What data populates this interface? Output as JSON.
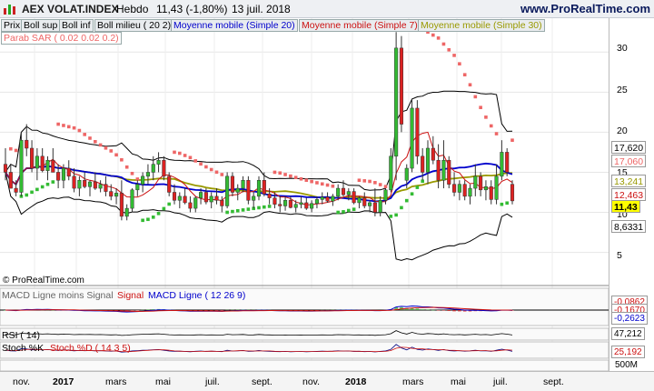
{
  "header": {
    "title": "AEX VOLAT.INDEX",
    "period": "Hebdo",
    "price": "11,43 (-1,80%)",
    "date": "13 juil. 2018",
    "site": "www.ProRealTime.com"
  },
  "toolbar": {
    "prix": "Prix",
    "boll_sup": "Boll sup",
    "boll_inf": "Boll inf",
    "boll_milieu": "Boll milieu ( 20 2)",
    "mm20": "Moyenne mobile (Simple 20)",
    "mm7": "Moyenne mobile (Simple 7)",
    "mm30": "Moyenne mobile (Simple 30)",
    "sar": "Parab SAR ( 0.02 0.02 0.2)"
  },
  "colors": {
    "candle_up": "#33bb33",
    "candle_down": "#dd2222",
    "bollinger": "#000000",
    "mm20": "#0000cc",
    "mm7": "#cc1111",
    "mm30": "#999900",
    "sar_up": "#33bb33",
    "sar_down": "#ee6666"
  },
  "price_axis": {
    "ticks": [
      "30",
      "25",
      "20",
      "15",
      "10",
      "5"
    ],
    "badges": [
      {
        "label": "17,620",
        "color": "#000000",
        "bg": "#ffffff"
      },
      {
        "label": "17,060",
        "color": "#ee6666",
        "bg": "#ffffff"
      },
      {
        "label": "13,241",
        "color": "#999900",
        "bg": "#ffffff"
      },
      {
        "label": "12,463",
        "color": "#cc1111",
        "bg": "#ffffff"
      },
      {
        "label": "11,43",
        "color": "#000000",
        "bg": "#ffff00"
      },
      {
        "label": "8,6331",
        "color": "#000000",
        "bg": "#ffffff"
      }
    ]
  },
  "chart_data": {
    "type": "candlestick",
    "ylim": [
      2,
      34
    ],
    "candles": [
      [
        16,
        18,
        14,
        15
      ],
      [
        15,
        16,
        13,
        13
      ],
      [
        13,
        14,
        12,
        12.5
      ],
      [
        12.5,
        20,
        12,
        19
      ],
      [
        19,
        21,
        17,
        18
      ],
      [
        18,
        19,
        15,
        15.5
      ],
      [
        15.5,
        18,
        14,
        17
      ],
      [
        17,
        18,
        15,
        15.2
      ],
      [
        15.2,
        17,
        14,
        16.5
      ],
      [
        16.5,
        18,
        15,
        15
      ],
      [
        15,
        16,
        13,
        14
      ],
      [
        14,
        16,
        13,
        15.5
      ],
      [
        15.5,
        16.5,
        14,
        14.5
      ],
      [
        14.5,
        15.5,
        12.5,
        13
      ],
      [
        13,
        14.5,
        12,
        14
      ],
      [
        14,
        15,
        13,
        13.2
      ],
      [
        13.2,
        14,
        12,
        13.8
      ],
      [
        13.8,
        15,
        12.8,
        13
      ],
      [
        13,
        14,
        12.5,
        13.5
      ],
      [
        13.5,
        14.5,
        12,
        12.6
      ],
      [
        12.6,
        13.5,
        11.5,
        12
      ],
      [
        12,
        13,
        11,
        12.4
      ],
      [
        12.4,
        14,
        9,
        9.5
      ],
      [
        9.5,
        11,
        9,
        10.5
      ],
      [
        10.5,
        13,
        10,
        12.8
      ],
      [
        12.8,
        14,
        12,
        13.5
      ],
      [
        13.5,
        15,
        12.5,
        14.5
      ],
      [
        14.5,
        16,
        13.5,
        15
      ],
      [
        15,
        17,
        14,
        16
      ],
      [
        16,
        17.5,
        15,
        16.5
      ],
      [
        16.5,
        17,
        14,
        14.5
      ],
      [
        14.5,
        15,
        12,
        12.5
      ],
      [
        12.5,
        13.5,
        11,
        11.5
      ],
      [
        11.5,
        12.5,
        10.5,
        12
      ],
      [
        12,
        13,
        11,
        11.2
      ],
      [
        11.2,
        12,
        10,
        10.5
      ],
      [
        10.5,
        12,
        10,
        11.8
      ],
      [
        11.8,
        13,
        11,
        12.5
      ],
      [
        12.5,
        13,
        11,
        11.3
      ],
      [
        11.3,
        12.5,
        10.5,
        12
      ],
      [
        12,
        13,
        11,
        11.5
      ],
      [
        11.5,
        12,
        10,
        10.8
      ],
      [
        10.8,
        15,
        10.5,
        14.5
      ],
      [
        14.5,
        15,
        12,
        12.5
      ],
      [
        12.5,
        13.5,
        11.5,
        13
      ],
      [
        13,
        14.5,
        12.5,
        14
      ],
      [
        14,
        14.5,
        11,
        11.5
      ],
      [
        11.5,
        12.5,
        10.5,
        12
      ],
      [
        12,
        14.5,
        11.5,
        14
      ],
      [
        14,
        15,
        12,
        12.3
      ],
      [
        12.3,
        13,
        11,
        11.8
      ],
      [
        11.8,
        12.5,
        10.5,
        11
      ],
      [
        11,
        12,
        10,
        10.8
      ],
      [
        10.8,
        12,
        10.2,
        11.5
      ],
      [
        11.5,
        12,
        10.5,
        10.6
      ],
      [
        10.6,
        11.5,
        10,
        11
      ],
      [
        11,
        12,
        10.5,
        11.2
      ],
      [
        11.2,
        11.8,
        10.3,
        10.5
      ],
      [
        10.5,
        11.5,
        10,
        11.1
      ],
      [
        11.1,
        12,
        10.5,
        11.6
      ],
      [
        11.6,
        12.5,
        11,
        11.9
      ],
      [
        11.9,
        12.5,
        11.2,
        11.4
      ],
      [
        11.4,
        12.3,
        10.8,
        12
      ],
      [
        12,
        13.5,
        11.5,
        13
      ],
      [
        13,
        14,
        12,
        12.2
      ],
      [
        12.2,
        13,
        11.5,
        12.6
      ],
      [
        12.6,
        13,
        11,
        11.2
      ],
      [
        11.2,
        12,
        10.5,
        11.8
      ],
      [
        11.8,
        12.5,
        10.5,
        10.8
      ],
      [
        10.8,
        11.5,
        10,
        11.2
      ],
      [
        11.2,
        13,
        9.5,
        10
      ],
      [
        10,
        12,
        9.5,
        11.5
      ],
      [
        11.5,
        13,
        11,
        12.8
      ],
      [
        12.8,
        18,
        12.5,
        17
      ],
      [
        17,
        32.5,
        14,
        30.5
      ],
      [
        30.5,
        32,
        20,
        21
      ],
      [
        14,
        16,
        13,
        15.5
      ],
      [
        15.5,
        24,
        15,
        23
      ],
      [
        23,
        24,
        16,
        17
      ],
      [
        17,
        18,
        14,
        15
      ],
      [
        15,
        19,
        13.5,
        18
      ],
      [
        18,
        19.5,
        16,
        16.5
      ],
      [
        16.5,
        18.5,
        13,
        14
      ],
      [
        14,
        19,
        13,
        16.5
      ],
      [
        16.5,
        17,
        13,
        13.5
      ],
      [
        13.5,
        15,
        12,
        12.5
      ],
      [
        12.5,
        14,
        11.5,
        13.5
      ],
      [
        13.5,
        14,
        11.5,
        12
      ],
      [
        12,
        13.5,
        11,
        13
      ],
      [
        13,
        16,
        12,
        14.5
      ],
      [
        14.5,
        15,
        12,
        12.8
      ],
      [
        12.8,
        14,
        11.5,
        13.2
      ],
      [
        13.2,
        14,
        11,
        11.6
      ],
      [
        11.6,
        16,
        11,
        14.5
      ],
      [
        14.5,
        19,
        14,
        17.5
      ],
      [
        17.5,
        18,
        14.5,
        15
      ],
      [
        13.5,
        14,
        11,
        11.43
      ]
    ]
  },
  "panels": {
    "macd": {
      "legend_a": "MACD Ligne moins Signal",
      "legend_b": "Signal",
      "legend_c": "MACD Ligne ( 12 26 9)",
      "badge1": "-0,0862",
      "badge2": "-0,1670",
      "badge3": "-0,2623"
    },
    "rsi": {
      "legend": "RSI ( 14)",
      "badge": "47,212"
    },
    "stoch": {
      "legend_a": "Stoch %K",
      "legend_b": "Stoch %D ( 14 3 5)",
      "badge": "25,192",
      "badge_vol": "500M"
    }
  },
  "x_labels": [
    "nov.",
    "2017",
    "mars",
    "mai",
    "juil.",
    "sept.",
    "nov.",
    "2018",
    "mars",
    "mai",
    "juil.",
    "sept."
  ],
  "footer": {
    "copyright": "© ProRealTime.com"
  }
}
